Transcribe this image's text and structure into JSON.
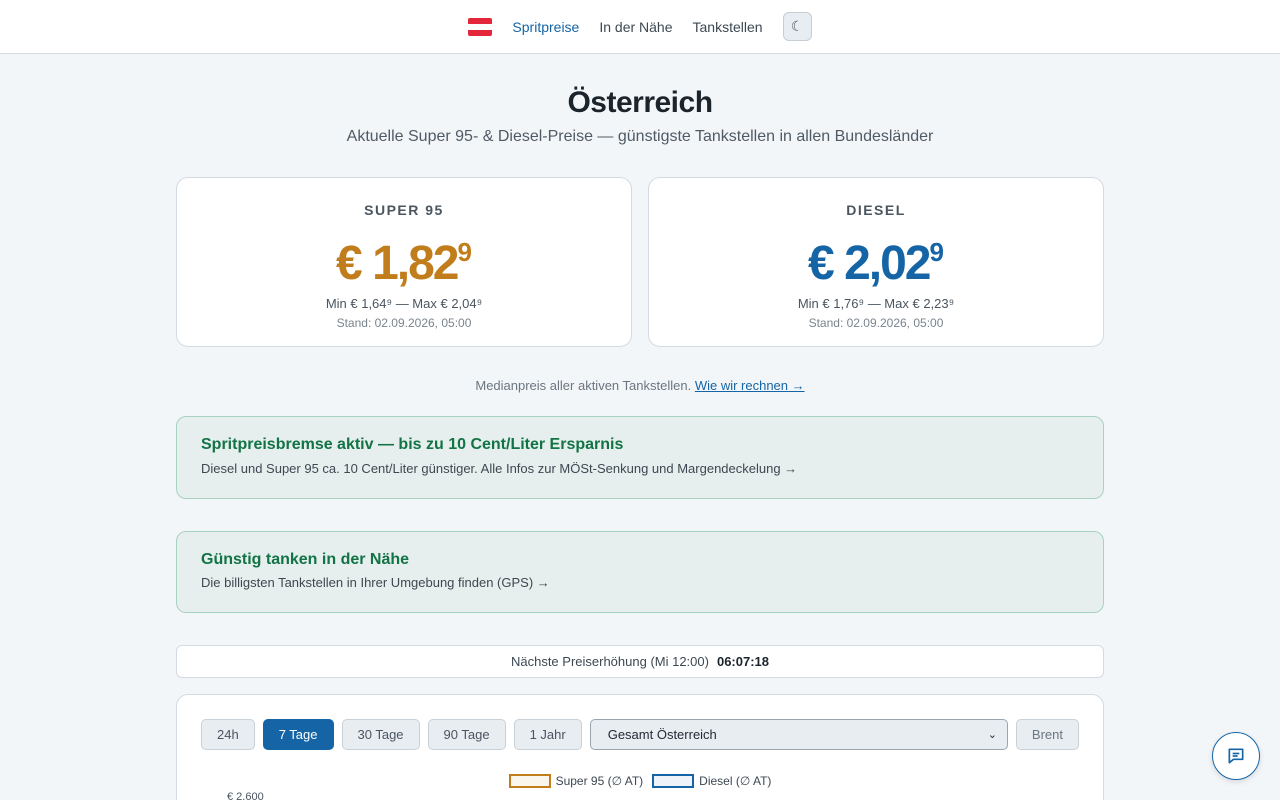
{
  "nav": {
    "flag_icon": "austria-flag-icon",
    "links": [
      "Spritpreise",
      "In der Nähe",
      "Tankstellen"
    ],
    "theme_toggle": "☾"
  },
  "header": {
    "title": "Österreich",
    "subtitle": "Aktuelle Super 95- & Diesel-Preise — günstigste Tankstellen in allen Bundesländer"
  },
  "cards": {
    "super": {
      "label": "SUPER 95",
      "price_main": "€ 1,82",
      "price_sup": "9",
      "minmax": "Min € 1,64⁹ — Max € 2,04⁹",
      "stand": "Stand: 02.09.2026, 05:00",
      "color": "#c17d1b"
    },
    "diesel": {
      "label": "DIESEL",
      "price_main": "€ 2,02",
      "price_sup": "9",
      "minmax": "Min € 1,76⁹ — Max € 2,23⁹",
      "stand": "Stand: 02.09.2026, 05:00",
      "color": "#1565a6"
    }
  },
  "median_note": {
    "text": "Medianpreis aller aktiven Tankstellen.",
    "link": "Wie wir rechnen →"
  },
  "banners": [
    {
      "title": "Spritpreisbremse aktiv — bis zu 10 Cent/Liter Ersparnis",
      "text": "Diesel und Super 95 ca. 10 Cent/Liter günstiger. Alle Infos zur MÖSt-Senkung und Margendeckelung →"
    },
    {
      "title": "Günstig tanken in der Nähe",
      "text": "Die billigsten Tankstellen in Ihrer Umgebung finden (GPS) →"
    }
  ],
  "countdown": {
    "label": "Nächste Preiserhöhung (Mi 12:00)",
    "value": "06:07:18"
  },
  "chart_controls": {
    "ranges": [
      "24h",
      "7 Tage",
      "30 Tage",
      "90 Tage",
      "1 Jahr"
    ],
    "active_range": "7 Tage",
    "region": "Gesamt Österreich",
    "brent": "Brent"
  },
  "chart_data": {
    "type": "line",
    "series": [
      {
        "name": "Super 95 (∅ AT)",
        "color": "#c17d1b"
      },
      {
        "name": "Diesel (∅ AT)",
        "color": "#1565a6"
      }
    ],
    "y_ticks": [
      "€ 2,600"
    ]
  },
  "chat": {
    "icon": "chat-bubble-icon"
  }
}
